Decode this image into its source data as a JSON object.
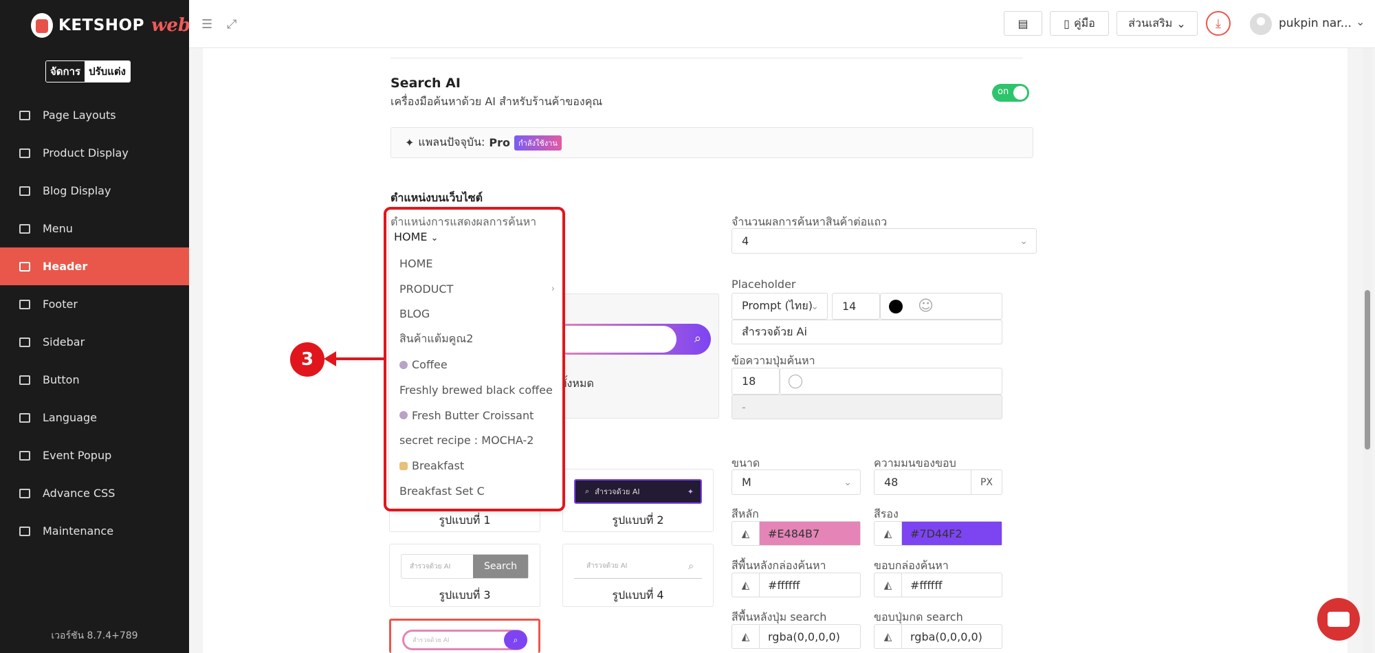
{
  "logo": {
    "text": "KETSHOP",
    "suffix": "web"
  },
  "mode_toggle": {
    "manage": "จัดการ",
    "customize": "ปรับแต่ง"
  },
  "sidebar": {
    "items": [
      {
        "label": "Page Layouts"
      },
      {
        "label": "Product Display"
      },
      {
        "label": "Blog Display"
      },
      {
        "label": "Menu"
      },
      {
        "label": "Header",
        "active": true
      },
      {
        "label": "Footer"
      },
      {
        "label": "Sidebar"
      },
      {
        "label": "Button"
      },
      {
        "label": "Language"
      },
      {
        "label": "Event Popup"
      },
      {
        "label": "Advance CSS"
      },
      {
        "label": "Maintenance"
      }
    ],
    "version": "เวอร์ชัน 8.7.4+789"
  },
  "topbar": {
    "manual": "คู่มือ",
    "addons": "ส่วนเสริม",
    "username": "pukpin nar..."
  },
  "search_ai": {
    "title": "Search AI",
    "subtitle": "เครื่องมือค้นหาด้วย AI สำหรับร้านค้าของคุณ",
    "toggle": "on",
    "plan_label": "แพลนปัจจุบัน:",
    "plan_name": "Pro",
    "plan_badge": "กำลังใช้งาน"
  },
  "position": {
    "section_title": "ตำแหน่งบนเว็บไซต์",
    "display_label": "ตำแหน่งการแสดงผลการค้นหา",
    "display_value": "HOME",
    "dropdown_options": [
      "HOME",
      "PRODUCT",
      "BLOG",
      "สินค้าแต้มคูณ2",
      "Coffee",
      "Freshly brewed black coffee",
      "Fresh Butter Croissant",
      "secret recipe : MOCHA-2",
      "Breakfast",
      "Breakfast Set C"
    ],
    "per_row_label": "จำนวนผลการค้นหาสินค้าต่อแถว",
    "per_row_value": "4"
  },
  "placeholder": {
    "label": "Placeholder",
    "font": "Prompt (ไทย)",
    "size": "14",
    "text": "สำรวจด้วย Ai"
  },
  "button_text": {
    "label": "ข้อความปุ่มค้นหา",
    "size": "18",
    "value": "-"
  },
  "preview": {
    "text": "ทั้งหมด"
  },
  "styles": {
    "style1": "รูปแบบที่ 1",
    "style2": "รูปแบบที่ 2",
    "style3": "รูปแบบที่ 3",
    "style4": "รูปแบบที่ 4",
    "preview_placeholder": "สำรวจด้วย AI",
    "search_btn": "Search"
  },
  "size": {
    "label": "ขนาด",
    "value": "M"
  },
  "radius": {
    "label": "ความมนของขอบ",
    "value": "48",
    "unit": "PX"
  },
  "colors": {
    "primary_label": "สีหลัก",
    "primary": "#E484B7",
    "secondary_label": "สีรอง",
    "secondary": "#7D44F2",
    "search_bg_label": "สีพื้นหลังกล่องค้นหา",
    "search_bg": "#ffffff",
    "search_border_label": "ขอบกล่องค้นหา",
    "search_border": "#ffffff",
    "btn_bg_label": "สีพื้นหลังปุ่ม search",
    "btn_bg": "rgba(0,0,0,0)",
    "btn_border_label": "ขอบปุ่มกด search",
    "btn_border": "rgba(0,0,0,0)"
  },
  "annotation": {
    "step": "3"
  }
}
